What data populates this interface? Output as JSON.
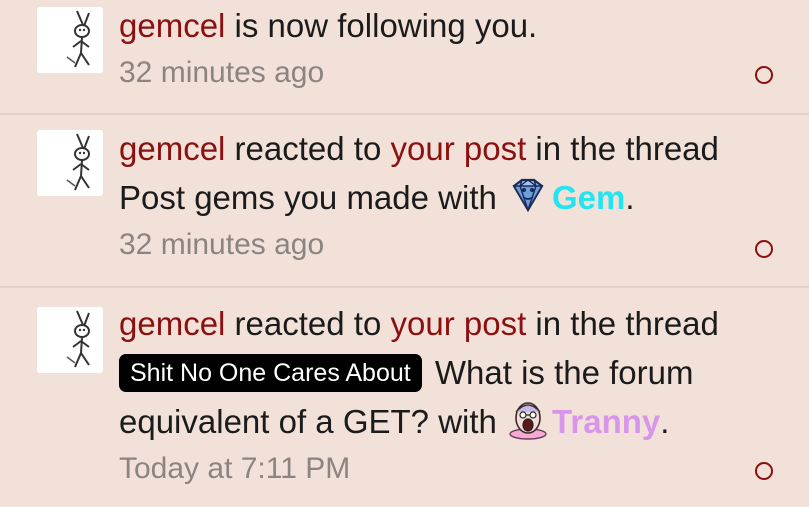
{
  "alerts": [
    {
      "user": "gemcel",
      "action": " is now following you.",
      "time": "32 minutes ago"
    },
    {
      "user": "gemcel",
      "action_pre": " reacted to ",
      "link": "your post",
      "action_post": " in the thread",
      "thread": "Post gems you made with ",
      "reaction_icon": "gem-diamond-icon",
      "reaction_name": "Gem",
      "end": ".",
      "time": "32 minutes ago"
    },
    {
      "user": "gemcel",
      "action_pre": " reacted to ",
      "link": "your post",
      "action_post": " in the thread",
      "thread_prefix": "Shit No One Cares About",
      "thread": " What is the forum equivalent of a GET? with ",
      "reaction_icon": "tranny-face-icon",
      "reaction_name": "Tranny",
      "end": ".",
      "time": "Today at 7:11 PM"
    }
  ],
  "colors": {
    "background": "#f1e1d8",
    "user_link": "#8b1010",
    "timestamp": "#8c8480",
    "gem": "#22e5f0",
    "tranny": "#d896ea"
  }
}
